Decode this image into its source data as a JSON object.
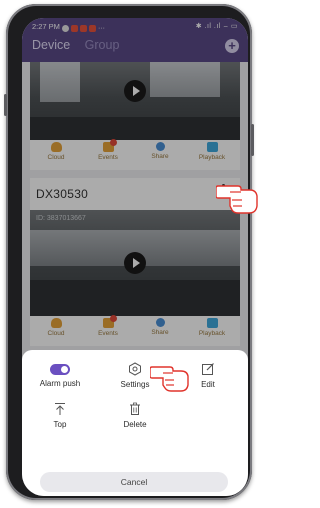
{
  "status_bar": {
    "time": "2:27 PM",
    "right_icons": "✱ .ıl .ıl ⌢ ▭"
  },
  "header": {
    "tabs": [
      {
        "label": "Device",
        "active": true
      },
      {
        "label": "Group",
        "active": false
      }
    ],
    "add_icon": "plus-icon",
    "background": "#5a4a87"
  },
  "device_cards": [
    {
      "name": "",
      "actions": [
        {
          "label": "Cloud",
          "icon": "cloud-icon"
        },
        {
          "label": "Events",
          "icon": "events-icon",
          "badge": true
        },
        {
          "label": "Share",
          "icon": "share-icon"
        },
        {
          "label": "Playback",
          "icon": "playback-icon"
        }
      ]
    },
    {
      "name": "DX30530",
      "device_id": "ID: 3837013667",
      "actions": [
        {
          "label": "Cloud",
          "icon": "cloud-icon"
        },
        {
          "label": "Events",
          "icon": "events-icon",
          "badge": true
        },
        {
          "label": "Share",
          "icon": "share-icon"
        },
        {
          "label": "Playback",
          "icon": "playback-icon"
        }
      ]
    }
  ],
  "sheet": {
    "items": [
      {
        "label": "Alarm push",
        "icon": "toggle-icon",
        "on": true
      },
      {
        "label": "Settings",
        "icon": "hexagon-gear-icon"
      },
      {
        "label": "Edit",
        "icon": "edit-icon"
      },
      {
        "label": "Top",
        "icon": "arrow-top-icon"
      },
      {
        "label": "Delete",
        "icon": "trash-icon"
      }
    ],
    "cancel_label": "Cancel"
  },
  "colors": {
    "accent": "#6a4fc0",
    "action_label": "#9a7a40",
    "pointer_hand": "#e0332b"
  }
}
